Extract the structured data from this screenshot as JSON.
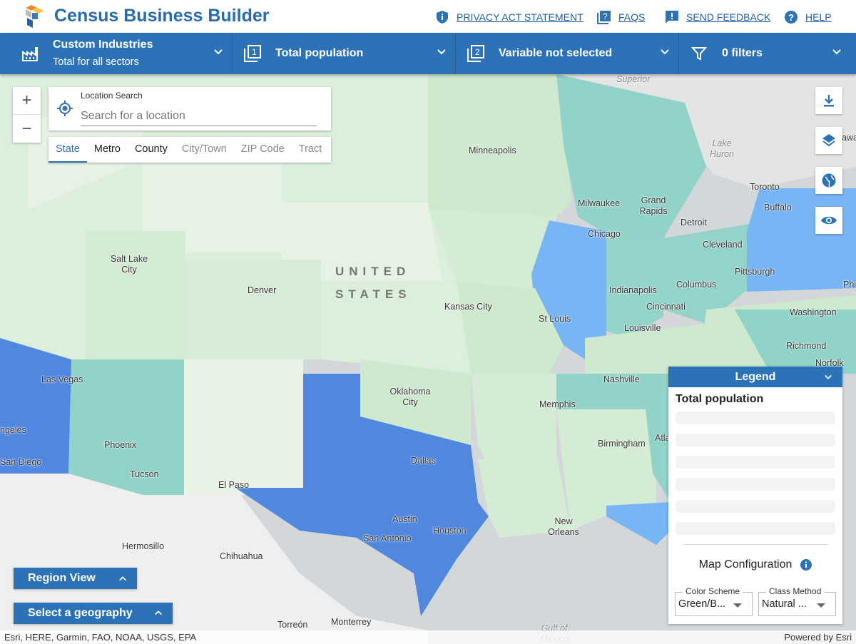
{
  "header": {
    "title": "Census Business Builder",
    "links": [
      {
        "label": "PRIVACY ACT STATEMENT",
        "icon": "shield-icon"
      },
      {
        "label": "FAQS",
        "icon": "question-box-icon"
      },
      {
        "label": "SEND FEEDBACK",
        "icon": "feedback-icon"
      },
      {
        "label": "HELP",
        "icon": "help-circle-icon"
      }
    ]
  },
  "navbar": {
    "industry_title": "Custom Industries",
    "industry_sub": "Total for all sectors",
    "variable1": "Total population",
    "variable2": "Variable not selected",
    "filters": "0 filters"
  },
  "search": {
    "label": "Location Search",
    "placeholder": "Search for a location"
  },
  "geo_tabs": [
    {
      "label": "State",
      "active": true
    },
    {
      "label": "Metro"
    },
    {
      "label": "County"
    },
    {
      "label": "City/Town",
      "disabled": true
    },
    {
      "label": "ZIP Code",
      "disabled": true
    },
    {
      "label": "Tract",
      "disabled": true
    }
  ],
  "map": {
    "country_label_1": "UNITED",
    "country_label_2": "STATES",
    "cities": [
      "Superior",
      "Minneapolis",
      "Lake Huron",
      "Toronto",
      "Buffalo",
      "Milwaukee",
      "Grand Rapids",
      "Detroit",
      "Chicago",
      "Cleveland",
      "Salt Lake City",
      "Pittsburgh",
      "Denver",
      "Columbus",
      "Indianapolis",
      "Philade",
      "Kansas City",
      "Cincinnati",
      "St Louis",
      "Washington",
      "Louisville",
      "Richmond",
      "Norfolk",
      "Las Vegas",
      "Nashville",
      "Oklahoma City",
      "Memphis",
      "ngeles",
      "Phoenix",
      "Atla",
      "Birmingham",
      "San Diego",
      "Dallas",
      "Tucson",
      "El Paso",
      "New Orleans",
      "Austin",
      "Houston",
      "San Antonio",
      "Hermosillo",
      "Chihuahua",
      "Torreón",
      "Monterrey",
      "Gulf of Mexico",
      "awa"
    ],
    "colors": {
      "light_green": "#dcefdc",
      "green": "#c9e6cc",
      "teal": "#92d3c9",
      "light_blue": "#78b5f5",
      "blue": "#5088e0"
    }
  },
  "legend": {
    "header": "Legend",
    "title": "Total population",
    "map_config": "Map Configuration",
    "color_scheme_label": "Color Scheme",
    "color_scheme_value": "Green/B...",
    "class_method_label": "Class Method",
    "class_method_value": "Natural ..."
  },
  "buttons": {
    "region_view": "Region View",
    "select_geography": "Select a geography"
  },
  "attribution": {
    "left": "Esri, HERE, Garmin, FAO, NOAA, USGS, EPA",
    "right": "Powered by Esri"
  }
}
